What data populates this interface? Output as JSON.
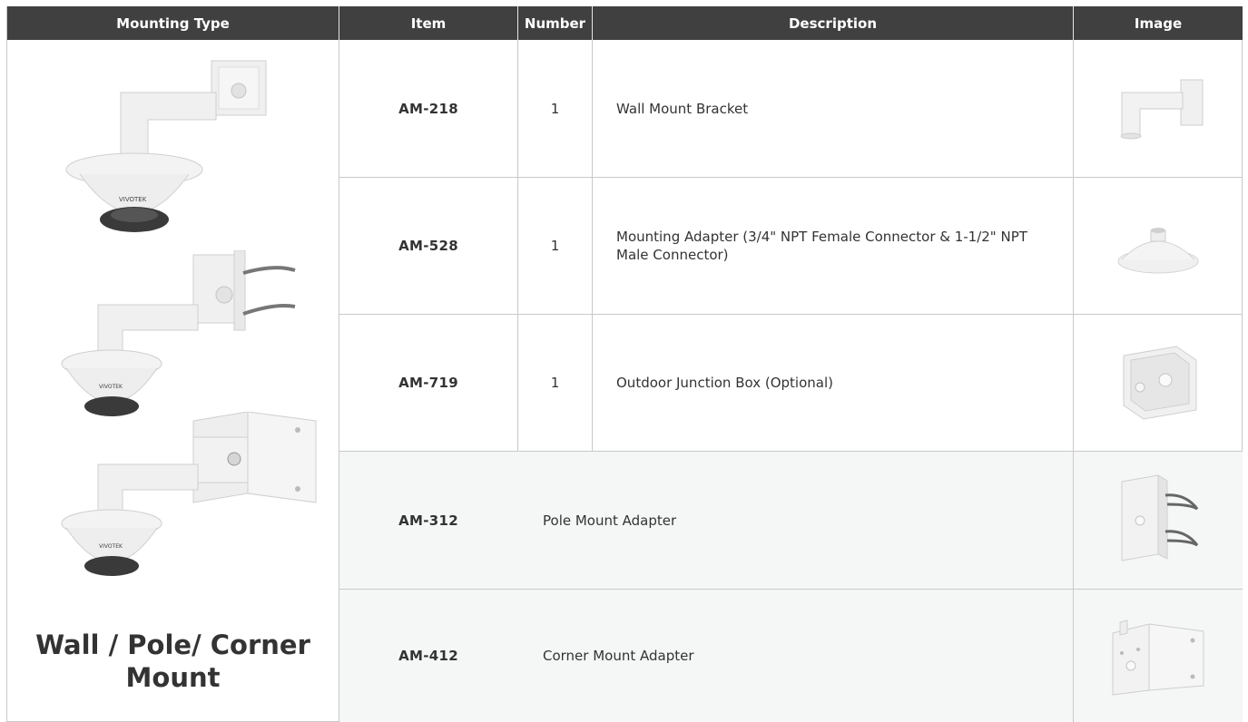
{
  "headers": {
    "mounting_type": "Mounting Type",
    "item": "Item",
    "number": "Number",
    "description": "Description",
    "image": "Image"
  },
  "mounting": {
    "title": "Wall / Pole/ Corner Mount",
    "photos": [
      "wall-mount-dome-camera",
      "pole-mount-dome-camera",
      "corner-mount-dome-camera"
    ]
  },
  "rows": [
    {
      "item": "AM-218",
      "number": "1",
      "description": "Wall Mount Bracket",
      "image": "wall-bracket-photo"
    },
    {
      "item": "AM-528",
      "number": "1",
      "description": "Mounting Adapter (3/4\" NPT Female Connector & 1-1/2\" NPT Male Connector)",
      "image": "mounting-adapter-photo"
    },
    {
      "item": "AM-719",
      "number": "1",
      "description": "Outdoor Junction Box (Optional)",
      "image": "junction-box-photo"
    },
    {
      "item": "AM-312",
      "description": "Pole Mount Adapter",
      "image": "pole-adapter-photo"
    },
    {
      "item": "AM-412",
      "description": "Corner Mount Adapter",
      "image": "corner-adapter-photo"
    }
  ],
  "colors": {
    "header_bg": "#404040",
    "header_text": "#ffffff",
    "border": "#c9c9c9",
    "shaded_row": "#f4f7f5",
    "text": "#333333"
  }
}
